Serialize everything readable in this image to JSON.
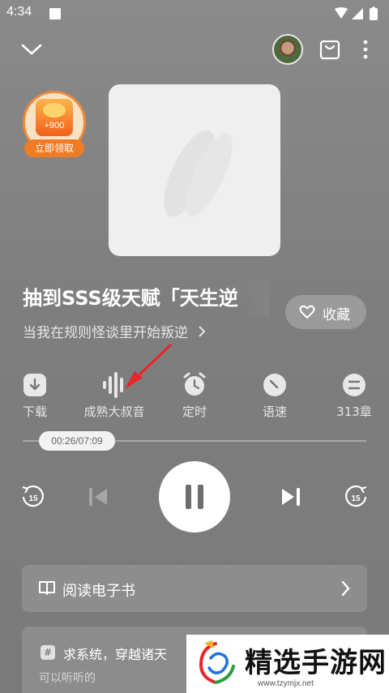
{
  "status_bar": {
    "time": "4:34"
  },
  "reward": {
    "amount": "+900",
    "claim_label": "立即领取"
  },
  "book": {
    "title": "抽到SSS级天赋「天生逆",
    "subtitle": "当我在规则怪谈里开始叛逆",
    "favorite_label": "收藏"
  },
  "tools": {
    "download": "下载",
    "voice": "成熟大叔音",
    "timer": "定时",
    "speed": "语速",
    "chapters": "313章"
  },
  "player": {
    "time": "00:26/07:09",
    "progress": 0.06,
    "skip_back_seconds": "15",
    "skip_forward_seconds": "15"
  },
  "read_ebook": {
    "label": "阅读电子书"
  },
  "recommendation": {
    "hash": "#",
    "text": "求系统，穿越诸天",
    "sub": "可以听听的"
  },
  "watermark": {
    "text": "精选手游网",
    "url": "www.tzymjx.net"
  },
  "colors": {
    "accent_orange": "#f07b25",
    "arrow_red": "#e8262b"
  }
}
